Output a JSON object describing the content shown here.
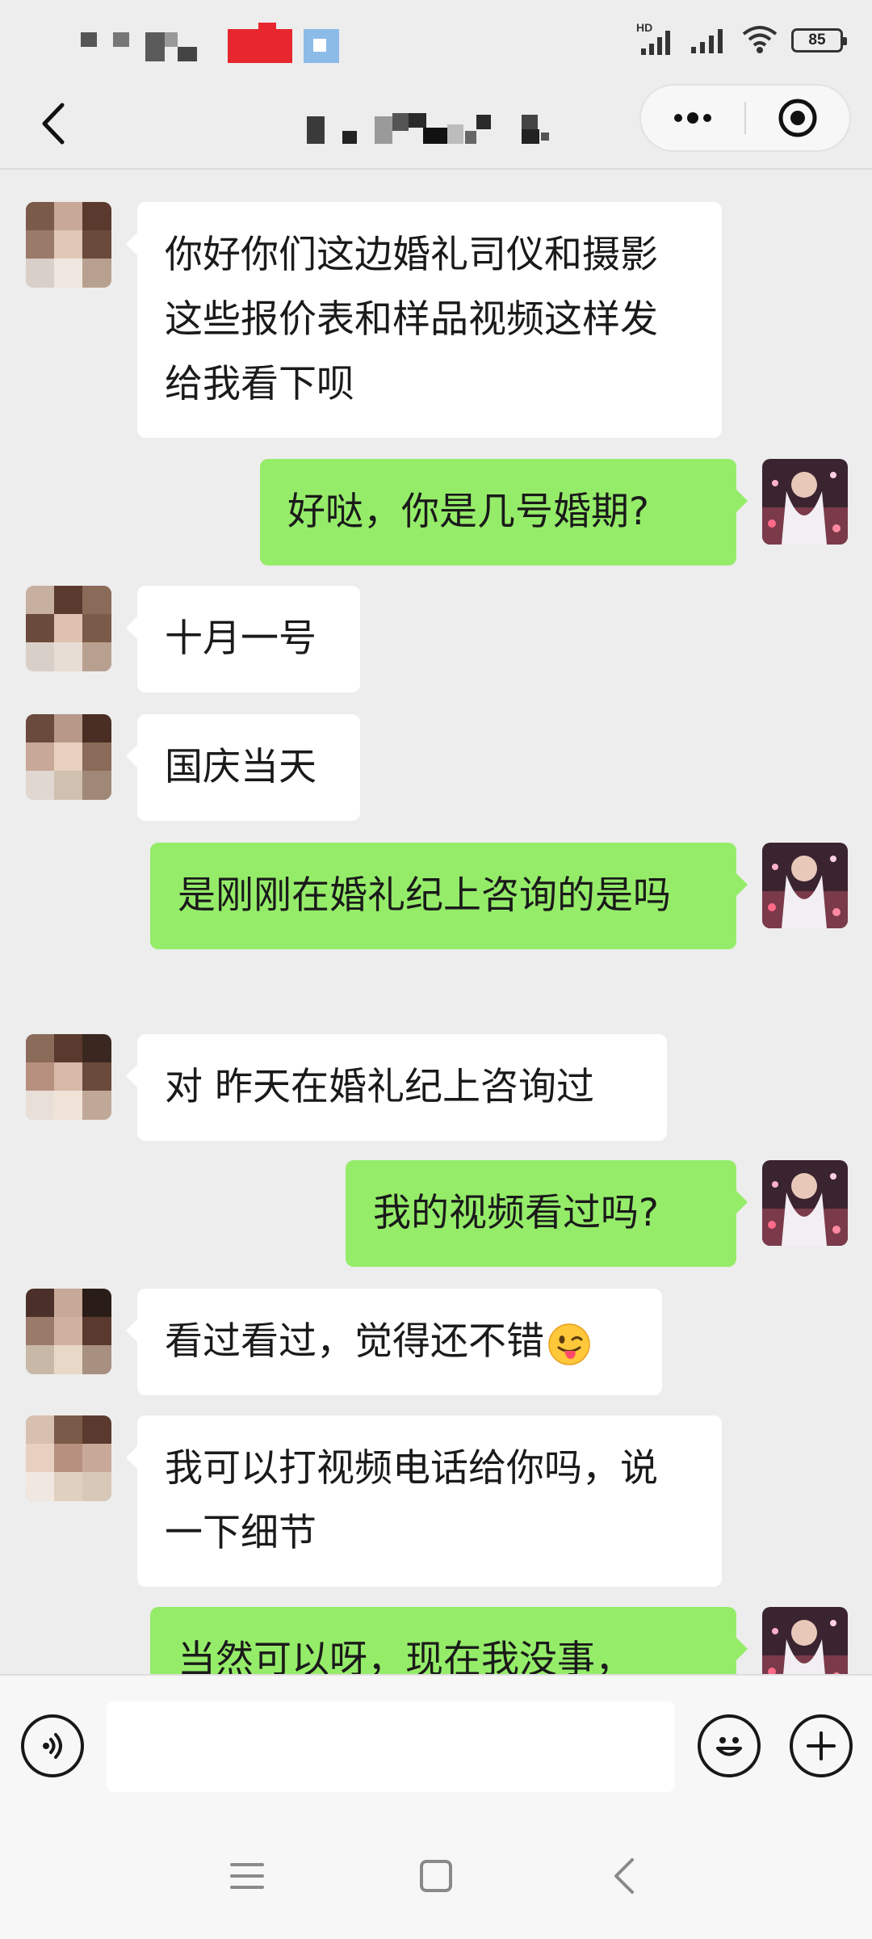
{
  "status_bar": {
    "battery_level": "85",
    "network_label": "HD"
  },
  "header": {
    "title": "(blurred contact name)"
  },
  "messages": [
    {
      "side": "left",
      "text": "你好你们这边婚礼司仪和摄影这些报价表和样品视频这样发给我看下呗"
    },
    {
      "side": "right",
      "text": "好哒，你是几号婚期?"
    },
    {
      "side": "left",
      "text": "十月一号"
    },
    {
      "side": "left",
      "text": "国庆当天"
    },
    {
      "side": "right",
      "text": "是刚刚在婚礼纪上咨询的是吗"
    },
    {
      "side": "left",
      "text": "对 昨天在婚礼纪上咨询过"
    },
    {
      "side": "right",
      "text": "我的视频看过吗?"
    },
    {
      "side": "left",
      "text": "看过看过，觉得还不错",
      "emoji": "winking-tongue-emoji"
    },
    {
      "side": "left",
      "text": "我可以打视频电话给你吗，说一下细节"
    },
    {
      "side": "right",
      "text": "当然可以呀，现在我没事，"
    }
  ],
  "input": {
    "value": "",
    "placeholder": ""
  },
  "colors": {
    "background": "#ededed",
    "bubble_mine": "#95ec69",
    "bubble_theirs": "#ffffff"
  }
}
